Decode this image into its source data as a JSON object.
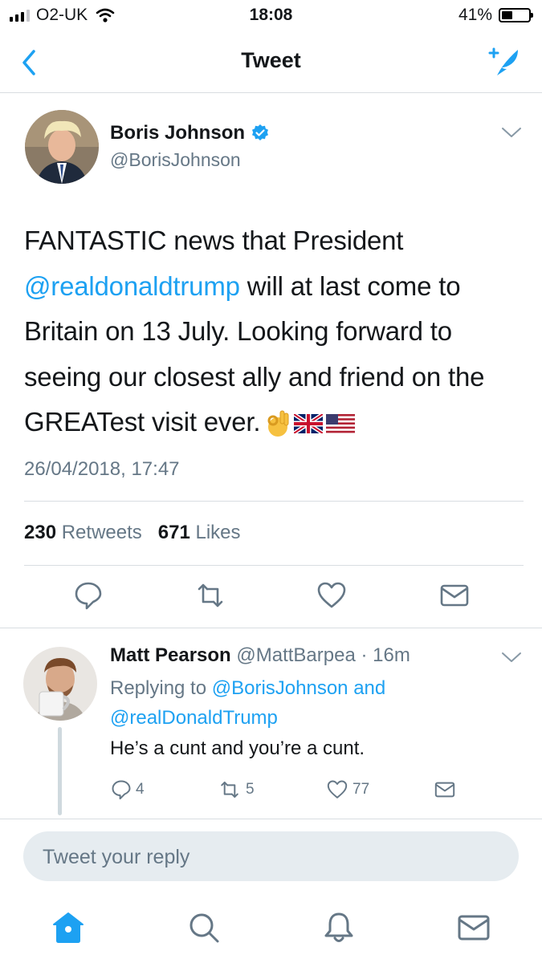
{
  "status_bar": {
    "carrier": "O2-UK",
    "time": "18:08",
    "battery": "41%",
    "battery_level": 0.41
  },
  "navbar": {
    "title": "Tweet",
    "back_icon": "chevron-left-icon",
    "compose_icon": "compose-tweet-icon"
  },
  "tweet": {
    "author_name": "Boris Johnson",
    "author_handle": "@BorisJohnson",
    "text_parts": {
      "p1": "FANTASTIC news that President",
      "mention": "@realdonaldtrump",
      "p2": " will at last come to Britain on 13 July.  Looking forward to seeing our closest ally and friend on the GREATest visit ever."
    },
    "emojis": [
      "ok-hand-emoji",
      "uk-flag-emoji",
      "us-flag-emoji"
    ],
    "timestamp": "26/04/2018, 17:47",
    "retweets_count": "230",
    "retweets_label": "Retweets",
    "likes_count": "671",
    "likes_label": "Likes"
  },
  "reply": {
    "name": "Matt Pearson",
    "meta": "@MattBarpea · 16m",
    "replying_prefix": "Replying to",
    "replying_mention1": "@BorisJohnson",
    "replying_and": "and",
    "replying_mention2": "@realDonaldTrump",
    "text": "He’s a cunt and you’re a cunt.",
    "reply_count": "4",
    "retweet_count": "5",
    "like_count": "77"
  },
  "reply_box": {
    "placeholder": "Tweet your reply"
  },
  "tabbar": {
    "tabs": [
      "home-icon",
      "search-icon",
      "notifications-icon",
      "messages-icon"
    ]
  },
  "colors": {
    "accent": "#1da1f2",
    "secondary_text": "#657786",
    "divider": "#d8dde1",
    "reply_box_bg": "#e6ecf0"
  }
}
